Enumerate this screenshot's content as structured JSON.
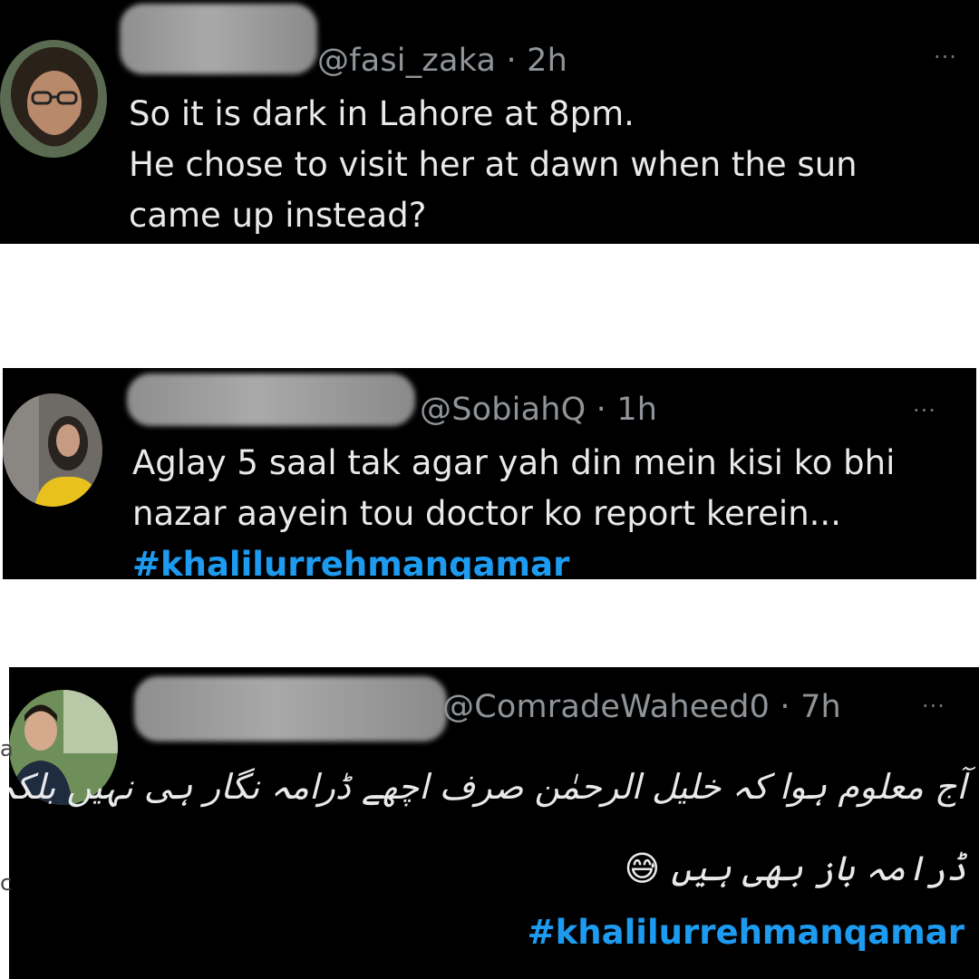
{
  "tweets": [
    {
      "handle": "@fasi_zaka",
      "time": "2h",
      "lines": [
        "So it is dark in Lahore at 8pm.",
        "He chose to visit her at dawn when the sun",
        "came up instead?"
      ],
      "more": "···"
    },
    {
      "handle": "@SobiahQ",
      "time": "1h",
      "lines": [
        "Aglay 5 saal tak agar yah din mein kisi ko bhi",
        "nazar aayein tou doctor ko report kerein..."
      ],
      "hashtag": "#khalilurrehmanqamar",
      "more": "···"
    },
    {
      "handle": "@ComradeWaheed0",
      "time": "7h",
      "lines": [
        "آج معلوم ہوا کہ خلیل الرحمٰن صرف اچھے ڈرامہ نگار ہی نہیں بلکہ اچھے",
        "ڈرامہ باز بھی ہیں 😅"
      ],
      "hashtag": "#khalilurrehmanqamar",
      "more": "···"
    }
  ],
  "side_fragments": [
    "a",
    "c"
  ],
  "colors": {
    "background": "#000000",
    "text": "#e7e9ea",
    "muted": "#8f9499",
    "link": "#1d9bf0"
  }
}
